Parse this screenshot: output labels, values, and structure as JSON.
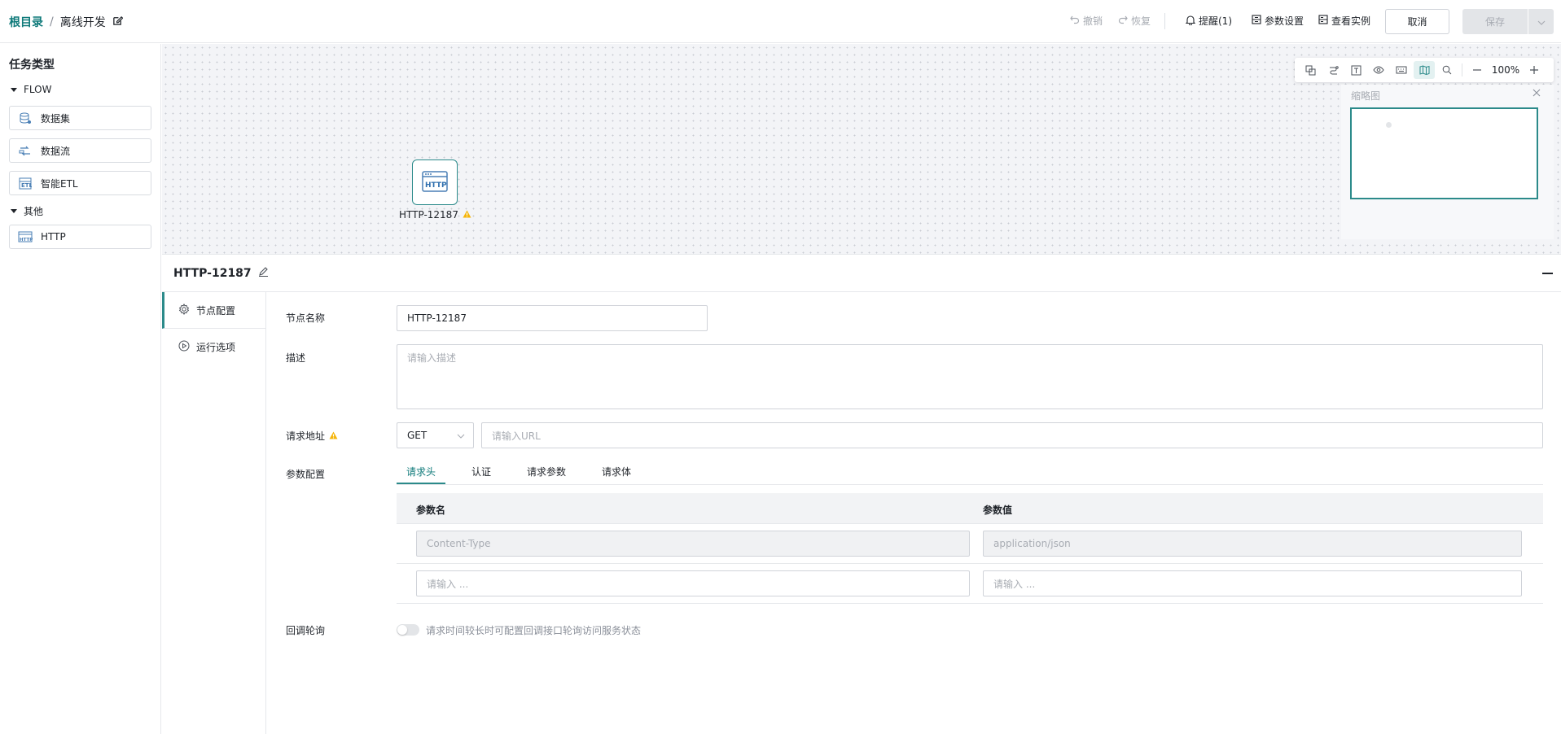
{
  "header": {
    "breadcrumb_root": "根目录",
    "breadcrumb_sep": "/",
    "breadcrumb_current": "离线开发",
    "undo": "撤销",
    "redo": "恢复",
    "remind": "提醒(1)",
    "params": "参数设置",
    "instances": "查看实例",
    "cancel": "取消",
    "save": "保存"
  },
  "sidebar": {
    "title": "任务类型",
    "groups": [
      {
        "label": "FLOW",
        "items": [
          "数据集",
          "数据流",
          "智能ETL"
        ]
      },
      {
        "label": "其他",
        "items": [
          "HTTP"
        ]
      }
    ]
  },
  "canvas": {
    "node_label": "HTTP-12187",
    "node_icon_text": "HTTP",
    "zoom": "100%",
    "minimap_title": "缩略图"
  },
  "panel": {
    "title": "HTTP-12187",
    "tabs": [
      "节点配置",
      "运行选项"
    ],
    "form": {
      "name_label": "节点名称",
      "name_value": "HTTP-12187",
      "desc_label": "描述",
      "desc_placeholder": "请输入描述",
      "url_label": "请求地址",
      "method": "GET",
      "url_placeholder": "请输入URL",
      "param_label": "参数配置",
      "param_tabs": [
        "请求头",
        "认证",
        "请求参数",
        "请求体"
      ],
      "table_headers": [
        "参数名",
        "参数值"
      ],
      "rows": [
        {
          "name": "Content-Type",
          "value": "application/json"
        }
      ],
      "row_placeholder": "请输入 ...",
      "callback_label": "回调轮询",
      "callback_hint": "请求时间较长时可配置回调接口轮询访问服务状态"
    }
  },
  "colors": {
    "accent": "#2b8a8a",
    "warning": "#f5b50a"
  }
}
